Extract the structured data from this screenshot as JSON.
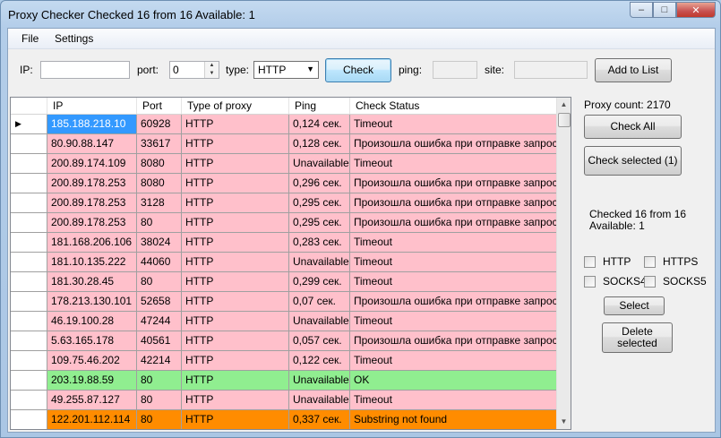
{
  "window": {
    "title": "Proxy Checker Checked 16 from 16 Available: 1",
    "minimize_glyph": "–",
    "maximize_glyph": "□",
    "close_glyph": "✕"
  },
  "menu": {
    "file": "File",
    "settings": "Settings"
  },
  "toolbar": {
    "ip_label": "IP:",
    "ip_value": "",
    "port_label": "port:",
    "port_value": "0",
    "type_label": "type:",
    "type_value": "HTTP",
    "check_button": "Check",
    "ping_label": "ping:",
    "ping_value": "",
    "site_label": "site:",
    "site_value": "",
    "add_button": "Add to List"
  },
  "grid": {
    "columns": [
      "IP",
      "Port",
      "Type of proxy",
      "Ping",
      "Check Status"
    ],
    "row_indicator": "▶",
    "rows": [
      {
        "ip": "185.188.218.10",
        "port": "60928",
        "type": "HTTP",
        "ping": "0,124 сек.",
        "status": "Timeout",
        "state": "fail"
      },
      {
        "ip": "80.90.88.147",
        "port": "33617",
        "type": "HTTP",
        "ping": "0,128 сек.",
        "status": "Произошла ошибка при отправке запроса.H",
        "state": "fail"
      },
      {
        "ip": "200.89.174.109",
        "port": "8080",
        "type": "HTTP",
        "ping": "Unavailable",
        "status": "Timeout",
        "state": "fail"
      },
      {
        "ip": "200.89.178.253",
        "port": "8080",
        "type": "HTTP",
        "ping": "0,296 сек.",
        "status": "Произошла ошибка при отправке запроса.H",
        "state": "fail"
      },
      {
        "ip": "200.89.178.253",
        "port": "3128",
        "type": "HTTP",
        "ping": "0,295 сек.",
        "status": "Произошла ошибка при отправке запроса.H",
        "state": "fail"
      },
      {
        "ip": "200.89.178.253",
        "port": "80",
        "type": "HTTP",
        "ping": "0,295 сек.",
        "status": "Произошла ошибка при отправке запроса.H",
        "state": "fail"
      },
      {
        "ip": "181.168.206.106",
        "port": "38024",
        "type": "HTTP",
        "ping": "0,283 сек.",
        "status": "Timeout",
        "state": "fail"
      },
      {
        "ip": "181.10.135.222",
        "port": "44060",
        "type": "HTTP",
        "ping": "Unavailable",
        "status": "Timeout",
        "state": "fail"
      },
      {
        "ip": "181.30.28.45",
        "port": "80",
        "type": "HTTP",
        "ping": "0,299 сек.",
        "status": "Timeout",
        "state": "fail"
      },
      {
        "ip": "178.213.130.101",
        "port": "52658",
        "type": "HTTP",
        "ping": "0,07 сек.",
        "status": "Произошла ошибка при отправке запроса.H",
        "state": "fail"
      },
      {
        "ip": "46.19.100.28",
        "port": "47244",
        "type": "HTTP",
        "ping": "Unavailable",
        "status": "Timeout",
        "state": "fail"
      },
      {
        "ip": "5.63.165.178",
        "port": "40561",
        "type": "HTTP",
        "ping": "0,057 сек.",
        "status": "Произошла ошибка при отправке запроса.H",
        "state": "fail"
      },
      {
        "ip": "109.75.46.202",
        "port": "42214",
        "type": "HTTP",
        "ping": "0,122 сек.",
        "status": "Timeout",
        "state": "fail"
      },
      {
        "ip": "203.19.88.59",
        "port": "80",
        "type": "HTTP",
        "ping": "Unavailable",
        "status": "OK",
        "state": "ok"
      },
      {
        "ip": "49.255.87.127",
        "port": "80",
        "type": "HTTP",
        "ping": "Unavailable",
        "status": "Timeout",
        "state": "fail"
      },
      {
        "ip": "122.201.112.114",
        "port": "80",
        "type": "HTTP",
        "ping": "0,337 сек.",
        "status": "Substring not found",
        "state": "warn"
      }
    ]
  },
  "colors": {
    "fail": "#ffc0cb",
    "ok": "#90ee90",
    "warn": "#ff8c00",
    "selected": "#3399ff"
  },
  "side": {
    "proxy_count": "Proxy count: 2170",
    "check_all": "Check All",
    "check_selected": "Check selected (1)",
    "checked_line1": "Checked 16 from 16",
    "checked_line2": "Available: 1",
    "cb_http": "HTTP",
    "cb_https": "HTTPS",
    "cb_socks4": "SOCKS4",
    "cb_socks5": "SOCKS5",
    "select": "Select",
    "delete_line1": "Delete",
    "delete_line2": "selected"
  },
  "scrollbar": {
    "up": "▲",
    "down": "▼"
  }
}
